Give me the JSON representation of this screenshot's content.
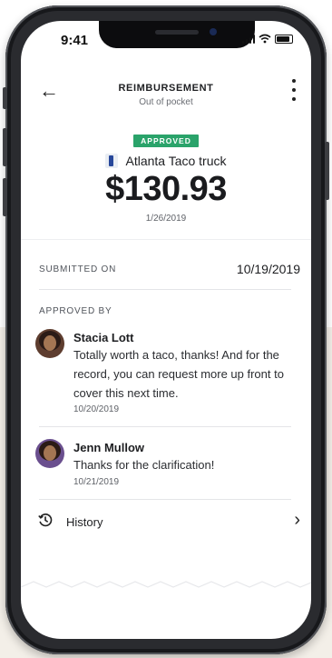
{
  "status_bar": {
    "time": "9:41"
  },
  "header": {
    "title": "REIMBURSEMENT",
    "subtitle": "Out of pocket"
  },
  "expense": {
    "status": "APPROVED",
    "merchant": "Atlanta Taco truck",
    "amount": "$130.93",
    "date": "1/26/2019"
  },
  "submitted": {
    "label": "SUBMITTED ON",
    "value": "10/19/2019"
  },
  "approved_by": {
    "label": "APPROVED BY",
    "comments": [
      {
        "name": "Stacia Lott",
        "text": "Totally worth a taco, thanks! And for the record, you can request more up front to cover this next time.",
        "date": "10/20/2019"
      },
      {
        "name": "Jenn Mullow",
        "text": "Thanks for the clarification!",
        "date": "10/21/2019"
      }
    ]
  },
  "history": {
    "label": "History"
  },
  "colors": {
    "approved": "#2aa36a",
    "text": "#1d1e21",
    "background": "#f3efe8"
  }
}
